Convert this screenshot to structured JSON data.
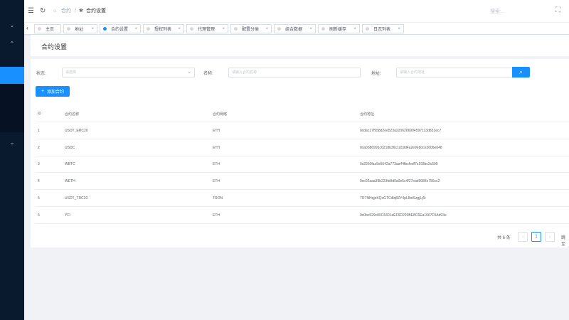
{
  "sidebar": {
    "chevron_top": "⌄",
    "chevron_second": "⌃",
    "chevron_bottom": "⌄"
  },
  "topbar": {
    "menu_icon": "☰",
    "refresh_icon": "↻",
    "breadcrumb": [
      "合约",
      "合约设置"
    ],
    "separator": "/",
    "search_placeholder": "搜索...",
    "fullscreen_icon": "⛶"
  },
  "tabs": {
    "scroll_left": "‹",
    "items": [
      {
        "label": "主页",
        "closable": false
      },
      {
        "label": "地址",
        "closable": true
      },
      {
        "label": "合约设置",
        "closable": true,
        "active": true
      },
      {
        "label": "授权列表",
        "closable": true
      },
      {
        "label": "代理管理",
        "closable": true
      },
      {
        "label": "配置分类",
        "closable": true
      },
      {
        "label": "组合数据",
        "closable": true
      },
      {
        "label": "刷新缓存",
        "closable": true
      },
      {
        "label": "日志列表",
        "closable": true
      }
    ],
    "close_glyph": "×"
  },
  "page": {
    "title": "合约设置"
  },
  "filters": {
    "status_label": "状态:",
    "status_placeholder": "请选择",
    "name_label": "名称:",
    "name_placeholder": "请输入合约名称",
    "address_label": "地址:",
    "address_placeholder": "请输入合约地址",
    "search_icon": "⌕"
  },
  "add_button": {
    "icon": "+",
    "label": "添加合约"
  },
  "table": {
    "headers": [
      "ID",
      "合约名称",
      "合约网络",
      "合约地址"
    ],
    "rows": [
      [
        "1",
        "USDT_ERC20",
        "ETH",
        "0xdac17f958d2ee523a2206206994597c13d831ec7"
      ],
      [
        "2",
        "USDC",
        "ETH",
        "0xa0b86991c6218b36c1d19d4a2e9eb0ce3606eb48"
      ],
      [
        "3",
        "WBTC",
        "ETH",
        "0x2260fac5e5542a773aa44fbcfedf7c193bc2c599"
      ],
      [
        "4",
        "WETH",
        "ETH",
        "0xc02aaa39b223fe8d0a0e5c4f27ead9083c756cc2"
      ],
      [
        "5",
        "USDT_TRC20",
        "TRON",
        "TR7NHqjeKQxGTCi8q8ZY4pL8otSzgjLj6t"
      ],
      [
        "6",
        "YFI",
        "ETH",
        "0x0bc529c00C6401aEF6D220BE8C6Ea1667F6Ad93e"
      ]
    ]
  },
  "pagination": {
    "total": "共 6 条",
    "prev": "‹",
    "current": "1",
    "next": "›",
    "jump": "跳至"
  },
  "colors": {
    "accent": "#1890ff",
    "sidebar": "#0a1a2e"
  }
}
